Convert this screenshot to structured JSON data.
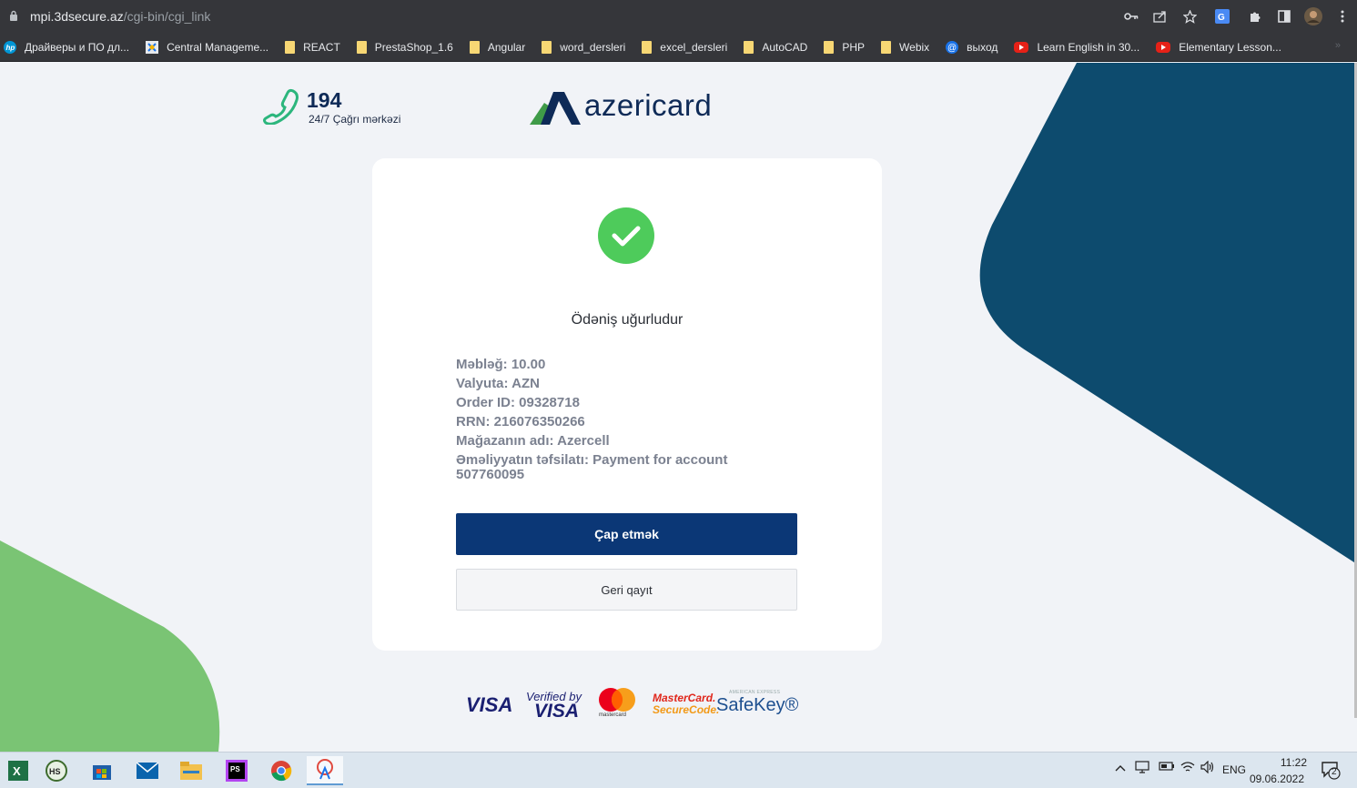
{
  "browser": {
    "url_host": "mpi.3dsecure.az",
    "url_path": "/cgi-bin/cgi_link",
    "bookmarks": [
      {
        "label": "Драйверы и ПО дл...",
        "icon": "hp-icon"
      },
      {
        "label": "Central Manageme...",
        "icon": "gear-puzzle-icon"
      },
      {
        "label": "REACT",
        "icon": "folder-icon"
      },
      {
        "label": "PrestaShop_1.6",
        "icon": "folder-icon"
      },
      {
        "label": "Angular",
        "icon": "folder-icon"
      },
      {
        "label": "word_dersleri",
        "icon": "folder-icon"
      },
      {
        "label": "excel_dersleri",
        "icon": "folder-icon"
      },
      {
        "label": "AutoCAD",
        "icon": "folder-icon"
      },
      {
        "label": "PHP",
        "icon": "folder-icon"
      },
      {
        "label": "Webix",
        "icon": "folder-icon"
      },
      {
        "label": "выход",
        "icon": "at-icon"
      },
      {
        "label": "Learn English in 30...",
        "icon": "youtube-icon"
      },
      {
        "label": "Elementary Lesson...",
        "icon": "youtube-icon"
      }
    ],
    "more_bookmarks": "»"
  },
  "header": {
    "hotline_number": "194",
    "hotline_subtitle": "24/7 Çağrı mərkəzi",
    "logo_text": "azericard"
  },
  "payment": {
    "status": "Ödəniş uğurludur",
    "details": [
      "Məbləğ: 10.00",
      "Valyuta: AZN",
      "Order ID: 09328718",
      "RRN: 216076350266",
      "Mağazanın adı: Azercell",
      "Əməliyyatın təfsilatı: Payment for account 507760095"
    ],
    "print_button": "Çap etmək",
    "back_button": "Geri qayıt"
  },
  "footer_logos": {
    "visa": "VISA",
    "verified_by": "Verified by",
    "verified_visa": "VISA",
    "mastercard": "mastercard",
    "securecode_1": "MasterCard.",
    "securecode_2": "SecureCode.",
    "amex": "AMERICAN EXPRESS",
    "safekey": "SafeKey®"
  },
  "taskbar": {
    "apps": [
      "excel-icon",
      "hs-icon",
      "store-icon",
      "mail-icon",
      "file-explorer-icon",
      "phpstorm-icon",
      "chrome-icon",
      "snipping-icon"
    ],
    "language": "ENG",
    "time": "11:22",
    "date": "09.06.2022",
    "notifications": "2"
  },
  "colors": {
    "navy": "#0b3776",
    "teal": "#0d4b6e",
    "green": "#7ac474",
    "success": "#4ecb5b"
  }
}
